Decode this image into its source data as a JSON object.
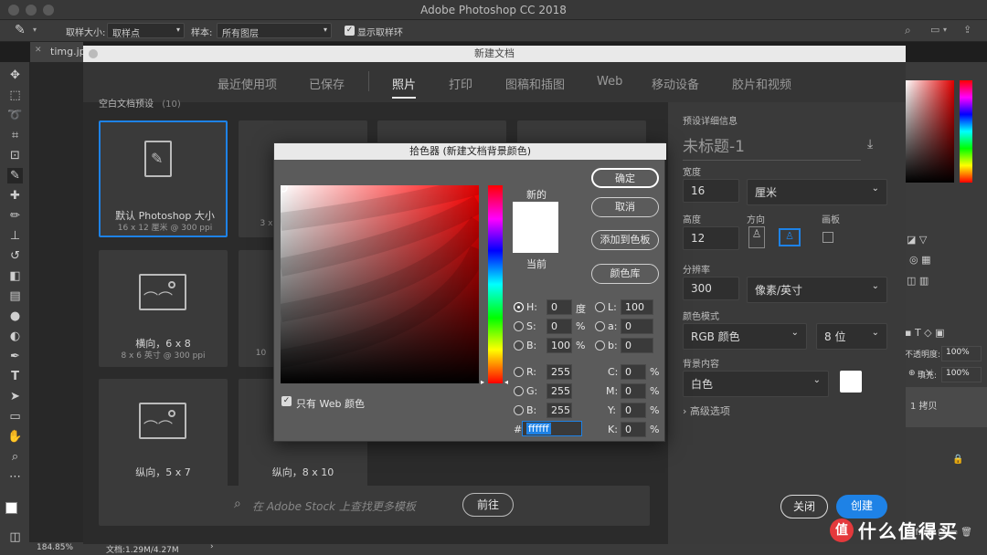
{
  "window": {
    "title": "Adobe Photoshop CC 2018"
  },
  "options_bar": {
    "sample_size_label": "取样大小:",
    "sample_size_value": "取样点",
    "sample_label": "样本:",
    "sample_value": "所有图层",
    "show_ring_label": "显示取样环"
  },
  "doc_tab": {
    "name": "timg.jp"
  },
  "status_bar": {
    "zoom": "184.85%",
    "doc_info": "文档:1.29M/4.27M"
  },
  "new_document": {
    "title": "新建文档",
    "tabs": [
      "最近使用项",
      "已保存",
      "照片",
      "打印",
      "图稿和插图",
      "Web",
      "移动设备",
      "胶片和视频"
    ],
    "active_tab": "照片",
    "presets_header": "空白文档预设",
    "presets_count": "(10)",
    "presets": [
      {
        "name": "默认 Photoshop 大小",
        "size": "16 x 12 厘米 @ 300 ppi"
      },
      {
        "name": "",
        "size": "3 x"
      },
      {
        "name": "横向，6 x 8",
        "size": "8 x 6 英寸 @ 300 ppi"
      },
      {
        "name": "",
        "size": "10"
      },
      {
        "name": "纵向，5 x 7",
        "size": ""
      },
      {
        "name": "纵向，8 x 10",
        "size": ""
      }
    ],
    "stock_search_placeholder": "在 Adobe Stock 上查找更多模板",
    "go_button": "前往",
    "details": {
      "header": "预设详细信息",
      "doc_name": "未标题-1",
      "width_label": "宽度",
      "width_value": "16",
      "width_unit": "厘米",
      "height_label": "高度",
      "height_value": "12",
      "orientation_label": "方向",
      "artboard_label": "画板",
      "resolution_label": "分辨率",
      "resolution_value": "300",
      "resolution_unit": "像素/英寸",
      "color_mode_label": "颜色模式",
      "color_mode_value": "RGB 颜色",
      "bit_depth_value": "8 位",
      "background_label": "背景内容",
      "background_value": "白色",
      "advanced_label": "高级选项",
      "close_button": "关闭",
      "create_button": "创建"
    }
  },
  "color_picker": {
    "title": "拾色器 (新建文档背景颜色)",
    "new_label": "新的",
    "current_label": "当前",
    "ok_button": "确定",
    "cancel_button": "取消",
    "add_swatch_button": "添加到色板",
    "libraries_button": "颜色库",
    "web_only_label": "只有 Web 颜色",
    "fields": {
      "H": "0",
      "S": "0",
      "B": "100",
      "R": "255",
      "G": "255",
      "B2": "255",
      "L": "100",
      "a": "0",
      "b": "0",
      "C": "0",
      "M": "0",
      "Y": "0",
      "K": "0",
      "hex": "ffffff"
    },
    "units": {
      "deg": "度",
      "pct": "%"
    },
    "new_color": "#ffffff",
    "current_color": "#ffffff"
  },
  "right_panel": {
    "opacity_label": "不透明度:",
    "opacity_value": "100%",
    "fill_label": "填充:",
    "fill_value": "100%",
    "layer_name": "1 拷贝"
  },
  "watermark": {
    "text": "什么值得买"
  },
  "colors": {
    "accent": "#1e82e6",
    "dialog_bg": "#353535",
    "picker_bg": "#5b5b5b"
  }
}
